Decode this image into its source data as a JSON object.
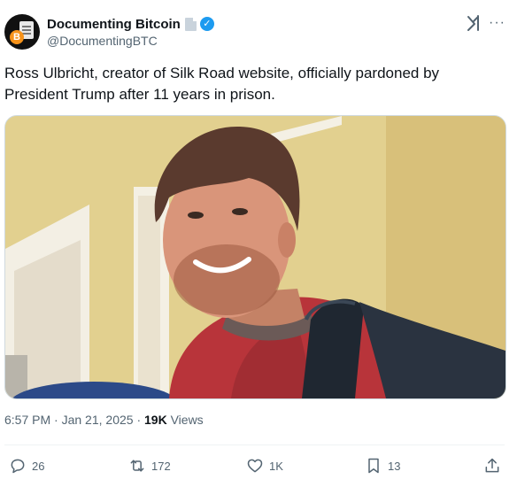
{
  "author": {
    "display_name": "Documenting Bitcoin",
    "handle": "@DocumentingBTC",
    "avatar_coin_glyph": "B"
  },
  "tweet": {
    "text": "Ross Ulbricht, creator of Silk Road website, officially pardoned by President Trump after 11 years in prison."
  },
  "meta": {
    "time": "6:57 PM",
    "separator": "·",
    "date": "Jan 21, 2025",
    "views_count": "19K",
    "views_label": "Views"
  },
  "actions": {
    "replies": "26",
    "reposts": "172",
    "likes": "1K",
    "bookmarks": "13"
  },
  "colors": {
    "verified": "#1d9bf0",
    "secondary_text": "#536471",
    "primary_text": "#0f1419"
  }
}
